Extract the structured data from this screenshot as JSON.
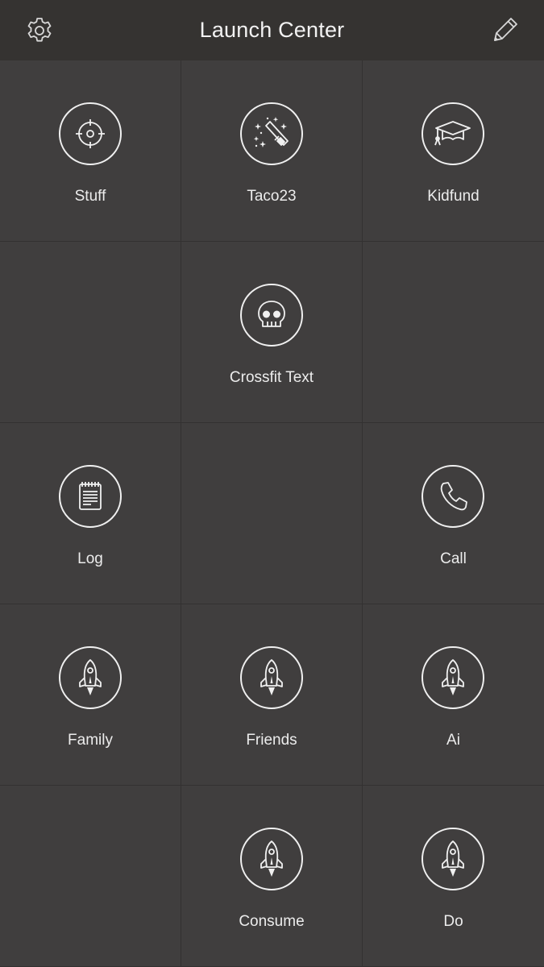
{
  "header": {
    "title": "Launch Center",
    "left_icon": "gear-icon",
    "right_icon": "pencil-icon"
  },
  "colors": {
    "background": "#403e3e",
    "header_background": "#353331",
    "icon_stroke": "#f0f0f0",
    "text": "#ececec"
  },
  "grid": {
    "cells": [
      {
        "label": "Stuff",
        "icon": "crosshair-icon"
      },
      {
        "label": "Taco23",
        "icon": "magic-wand-icon"
      },
      {
        "label": "Kidfund",
        "icon": "graduation-cap-icon"
      },
      {
        "label": "",
        "icon": ""
      },
      {
        "label": "Crossfit Text",
        "icon": "skull-icon"
      },
      {
        "label": "",
        "icon": ""
      },
      {
        "label": "Log",
        "icon": "notepad-icon"
      },
      {
        "label": "",
        "icon": ""
      },
      {
        "label": "Call",
        "icon": "phone-icon"
      },
      {
        "label": "Family",
        "icon": "rocket-icon"
      },
      {
        "label": "Friends",
        "icon": "rocket-icon"
      },
      {
        "label": "Ai",
        "icon": "rocket-icon"
      },
      {
        "label": "",
        "icon": ""
      },
      {
        "label": "Consume",
        "icon": "rocket-icon"
      },
      {
        "label": "Do",
        "icon": "rocket-icon"
      }
    ]
  }
}
